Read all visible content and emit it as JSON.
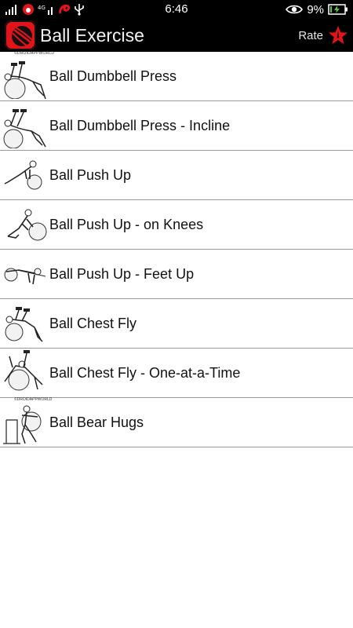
{
  "status_bar": {
    "time": "6:46",
    "battery": "9%",
    "icons": [
      "signal-icon",
      "vodafone-icon",
      "data-signal-icon",
      "airtel-icon",
      "usb-icon",
      "eye-icon",
      "battery-charging-icon"
    ]
  },
  "app_bar": {
    "title": "Ball Exercise",
    "rate_label": "Rate",
    "logo_icon": "exercise-ball-logo-icon",
    "rate_icon": "star-icon",
    "accent_color": "#e3131a"
  },
  "watermark": "©DROIDAPPWORLD",
  "exercises": [
    {
      "label": "Ball Dumbbell Press"
    },
    {
      "label": "Ball Dumbbell Press - Incline"
    },
    {
      "label": "Ball Push Up"
    },
    {
      "label": "Ball Push Up - on Knees"
    },
    {
      "label": "Ball Push Up - Feet Up"
    },
    {
      "label": "Ball Chest Fly"
    },
    {
      "label": "Ball Chest Fly - One-at-a-Time"
    },
    {
      "label": "Ball Bear Hugs"
    }
  ]
}
